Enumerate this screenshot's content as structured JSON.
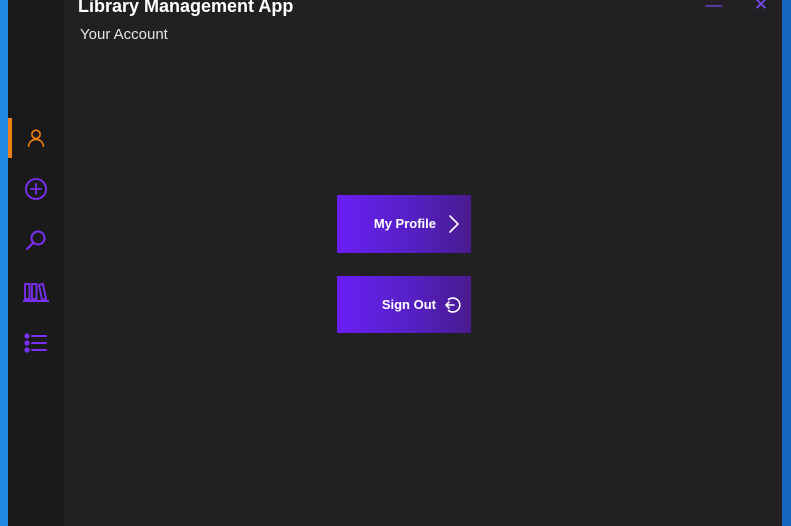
{
  "app": {
    "title": "Library Management App",
    "subtitle": "Your Account",
    "window_controls": {
      "minimize": "—",
      "close": "✕"
    }
  },
  "sidebar": {
    "active_item": "account",
    "items": [
      {
        "id": "account",
        "icon": "user-icon"
      },
      {
        "id": "add",
        "icon": "add-circle-icon"
      },
      {
        "id": "search",
        "icon": "search-icon"
      },
      {
        "id": "books",
        "icon": "books-icon"
      },
      {
        "id": "list",
        "icon": "list-icon"
      }
    ]
  },
  "actions": {
    "my_profile_label": "My Profile",
    "my_profile_icon": "chevron-right-icon",
    "sign_out_label": "Sign Out",
    "sign_out_icon": "sign-out-icon"
  },
  "colors": {
    "accent_purple": "#7b2ff7",
    "active_orange": "#f07f16",
    "background": "#222022",
    "sidebar": "#1a1a1a"
  }
}
